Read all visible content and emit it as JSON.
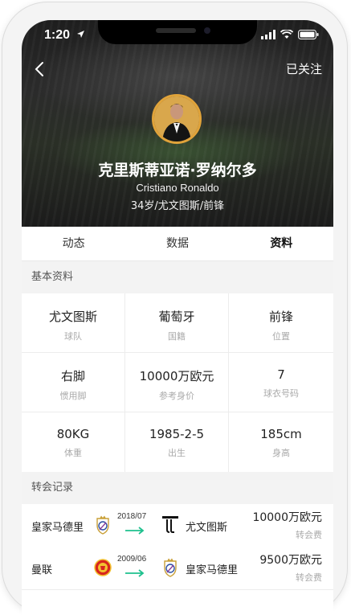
{
  "status_bar": {
    "time": "1:20"
  },
  "header": {
    "follow_label": "已关注",
    "name_cn": "克里斯蒂亚诺·罗纳尔多",
    "name_en": "Cristiano Ronaldo",
    "sub_info": "34岁/尤文图斯/前锋"
  },
  "tabs": [
    {
      "label": "动态"
    },
    {
      "label": "数据"
    },
    {
      "label": "资料"
    }
  ],
  "basic_info": {
    "title": "基本资料",
    "cells": [
      {
        "value": "尤文图斯",
        "label": "球队"
      },
      {
        "value": "葡萄牙",
        "label": "国籍"
      },
      {
        "value": "前锋",
        "label": "位置"
      },
      {
        "value": "右脚",
        "label": "惯用脚"
      },
      {
        "value": "10000万欧元",
        "label": "参考身价"
      },
      {
        "value": "7",
        "label": "球衣号码"
      },
      {
        "value": "80KG",
        "label": "体重"
      },
      {
        "value": "1985-2-5",
        "label": "出生"
      },
      {
        "value": "185cm",
        "label": "身高"
      }
    ]
  },
  "transfers": {
    "title": "转会记录",
    "rows": [
      {
        "from": "皇家马德里",
        "from_logo": "real-madrid-logo",
        "date": "2018/07",
        "to": "尤文图斯",
        "to_logo": "juventus-logo",
        "fee": "10000万欧元",
        "fee_label": "转会费"
      },
      {
        "from": "曼联",
        "from_logo": "manchester-united-logo",
        "date": "2009/06",
        "to": "皇家马德里",
        "to_logo": "real-madrid-logo",
        "fee": "9500万欧元",
        "fee_label": "转会费"
      }
    ]
  },
  "colors": {
    "accent_green": "#1fc08e",
    "avatar_border": "#e0a33a"
  }
}
